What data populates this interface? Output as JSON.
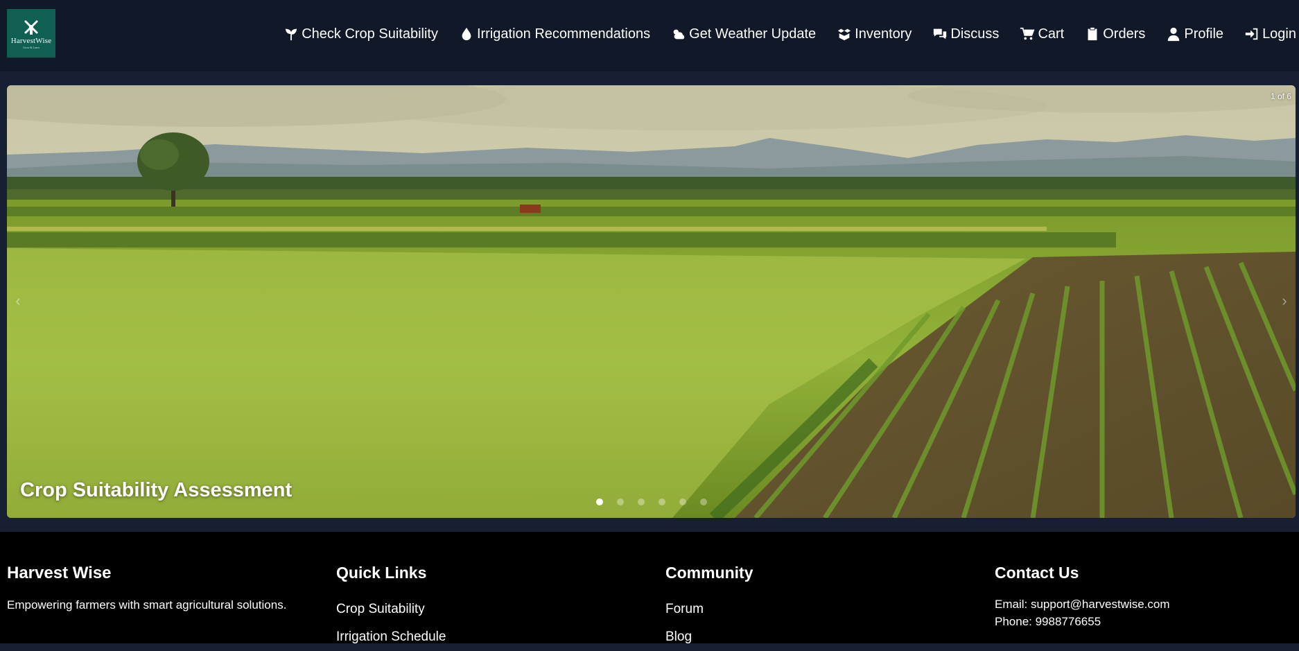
{
  "brand": {
    "logo_text": "HarvestWise",
    "logo_subtext": "Grow & Learn"
  },
  "nav": [
    {
      "icon": "seedling-icon",
      "label": "Check Crop Suitability"
    },
    {
      "icon": "droplet-icon",
      "label": "Irrigation Recommendations"
    },
    {
      "icon": "weather-cloud-icon",
      "label": "Get Weather Update"
    },
    {
      "icon": "open-box-icon",
      "label": "Inventory"
    },
    {
      "icon": "chat-bubbles-icon",
      "label": "Discuss"
    },
    {
      "icon": "cart-icon",
      "label": "Cart"
    },
    {
      "icon": "clipboard-icon",
      "label": "Orders"
    },
    {
      "icon": "user-icon",
      "label": "Profile"
    },
    {
      "icon": "login-icon",
      "label": "Login"
    }
  ],
  "carousel": {
    "counter": "1 of 6",
    "caption": "Crop Suitability Assessment",
    "slide_count": 6,
    "active_index": 0,
    "prev_icon": "chevron-left-icon",
    "next_icon": "chevron-right-icon"
  },
  "footer": {
    "about": {
      "title": "Harvest Wise",
      "text": "Empowering farmers with smart agricultural solutions."
    },
    "quick_links": {
      "title": "Quick Links",
      "items": [
        "Crop Suitability",
        "Irrigation Schedule"
      ]
    },
    "community": {
      "title": "Community",
      "items": [
        "Forum",
        "Blog"
      ]
    },
    "contact": {
      "title": "Contact Us",
      "email": "Email: support@harvestwise.com",
      "phone": "Phone: 9988776655"
    }
  },
  "colors": {
    "nav_bg": "#111827",
    "page_bg": "#172033",
    "footer_bg": "#000000",
    "logo_bg": "#0f5f52"
  }
}
